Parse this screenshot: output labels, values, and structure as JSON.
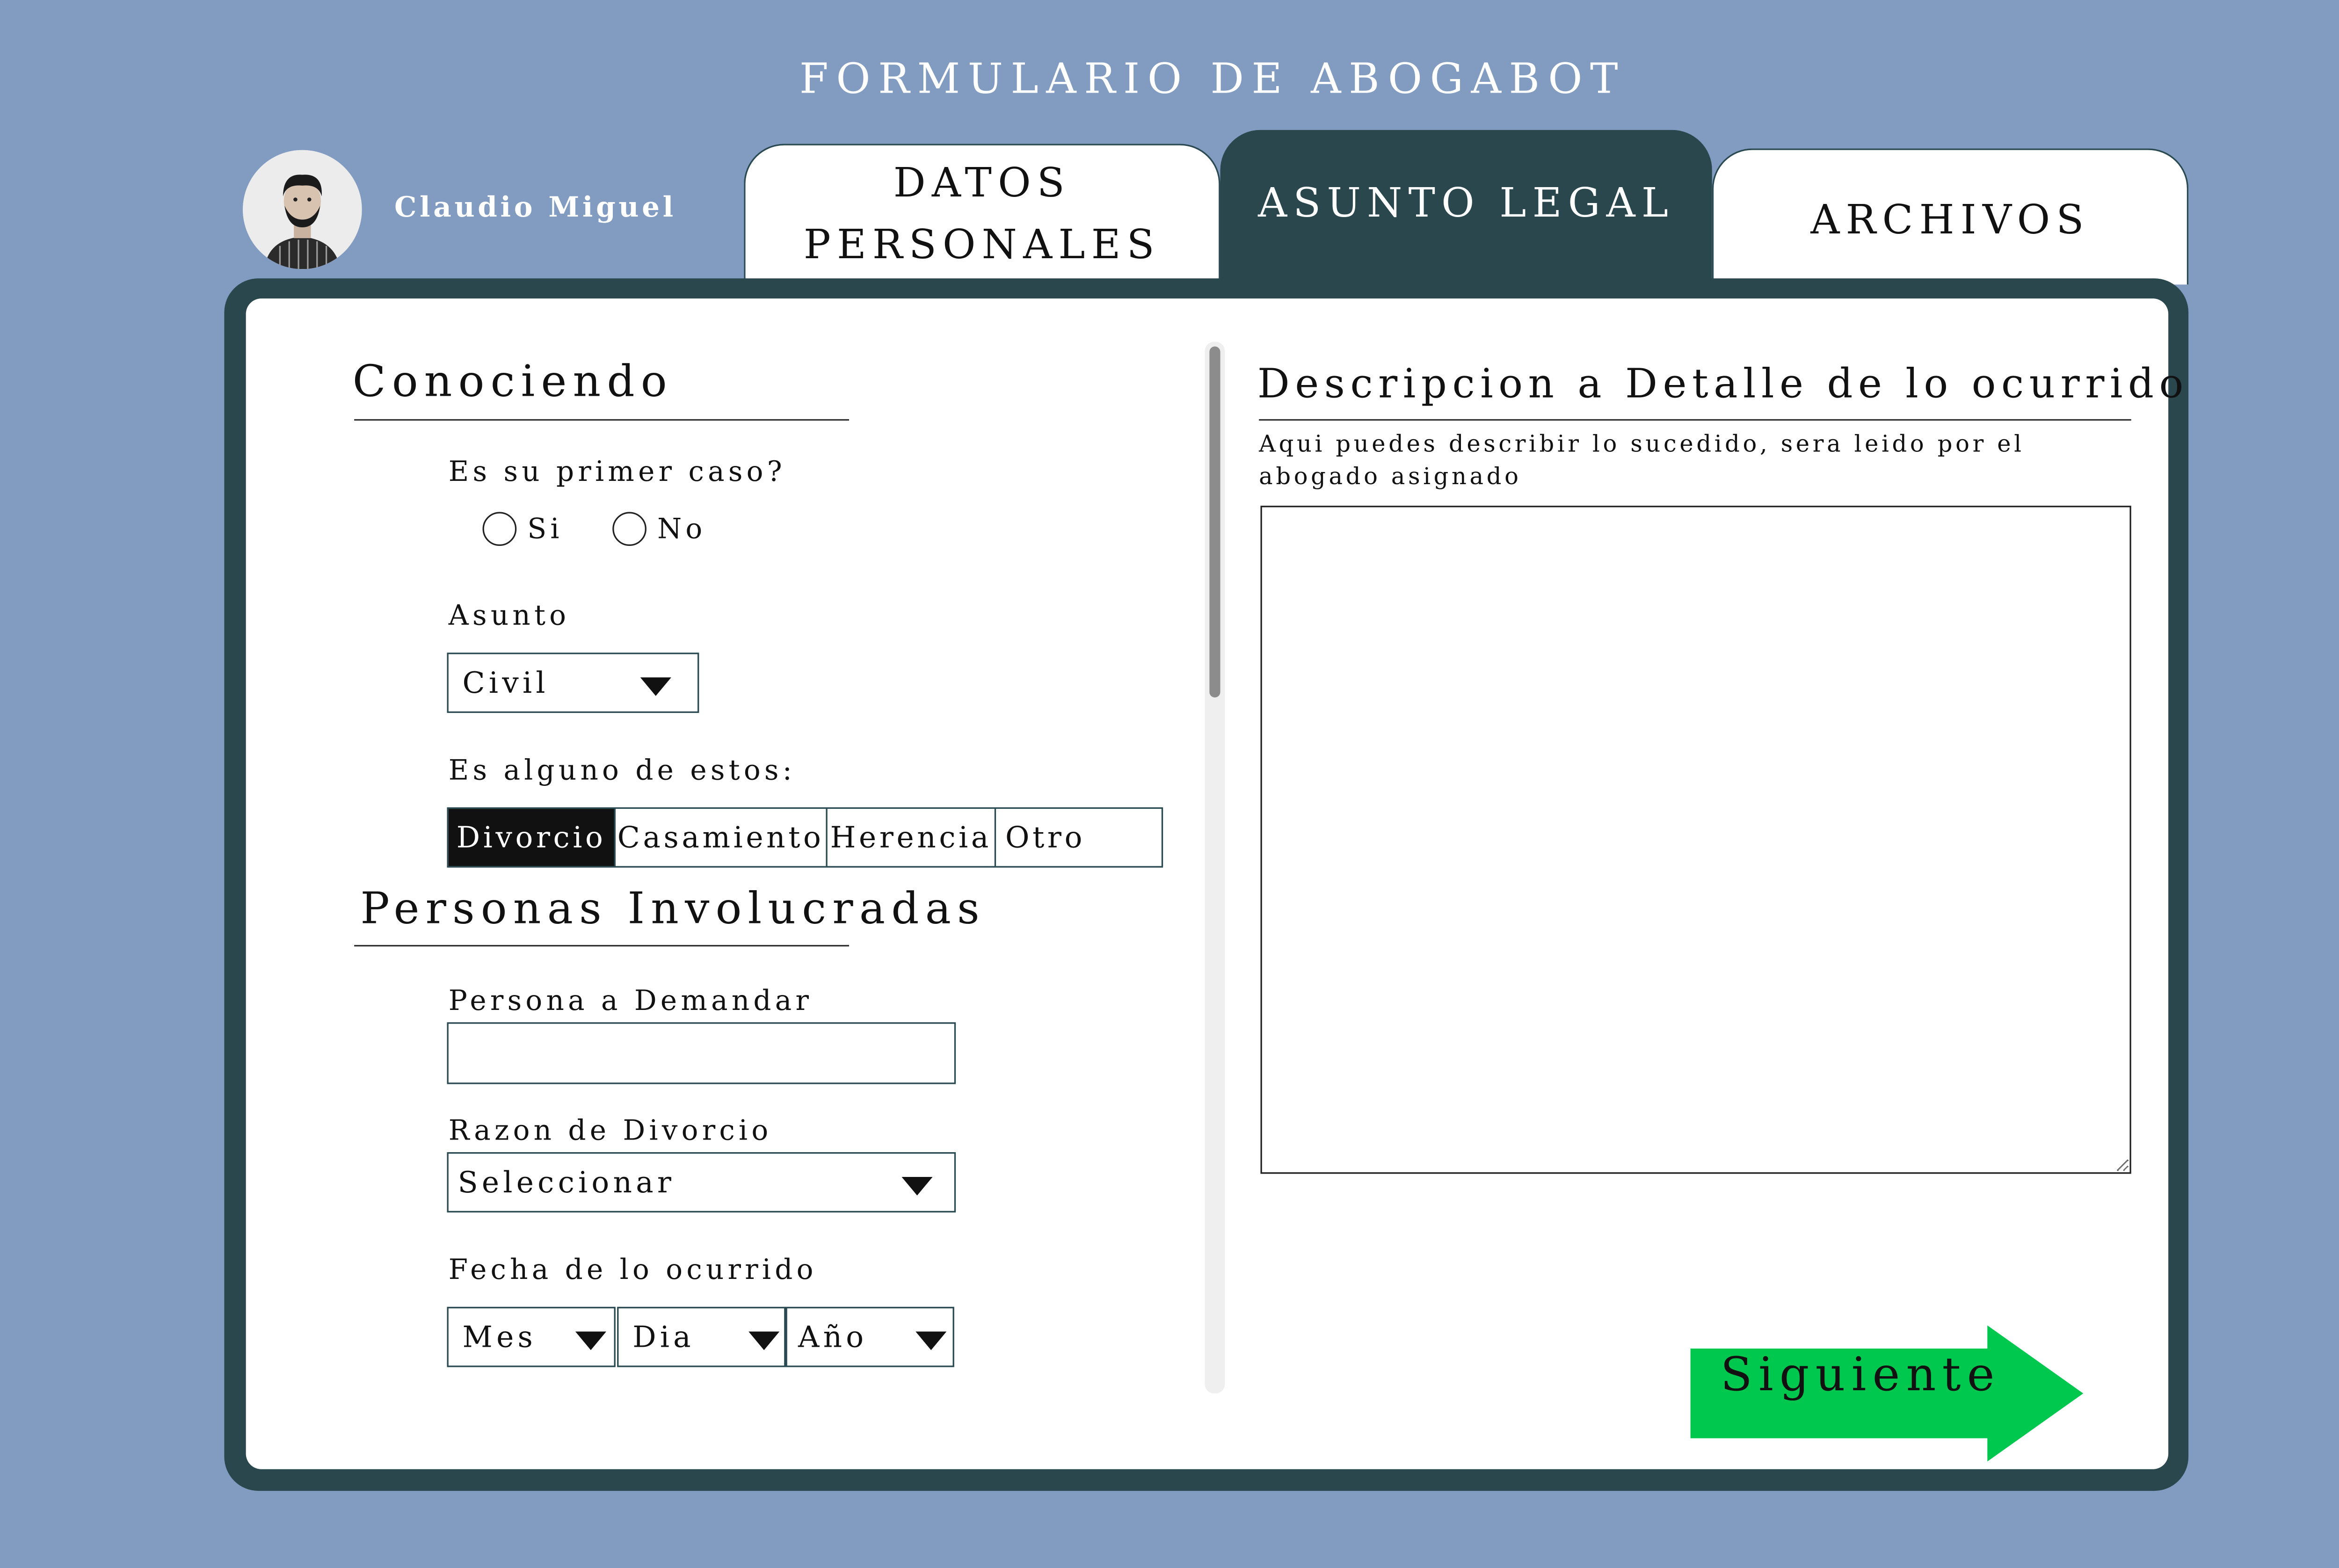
{
  "page": {
    "title": "FORMULARIO DE ABOGABOT"
  },
  "user": {
    "name": "Claudio Miguel"
  },
  "tabs": {
    "datos_line1": "DATOS",
    "datos_line2": "PERSONALES",
    "asunto": "ASUNTO LEGAL",
    "archivos": "ARCHIVOS",
    "active": "ASUNTO LEGAL"
  },
  "conociendo": {
    "title": "Conociendo",
    "primer_caso_label": "Es su primer caso?",
    "radio_si": "Si",
    "radio_no": "No",
    "asunto_label": "Asunto",
    "asunto_value": "Civil",
    "tipo_label": "Es alguno de estos:",
    "tipos": [
      "Divorcio",
      "Casamiento",
      "Herencia",
      "Otro"
    ],
    "tipo_selected": "Divorcio"
  },
  "personas": {
    "title": "Personas Involucradas",
    "demandar_label": "Persona a Demandar",
    "demandar_value": "",
    "razon_label": "Razon de Divorcio",
    "razon_value": "Seleccionar",
    "fecha_label": "Fecha de lo ocurrido",
    "mes": "Mes",
    "dia": "Dia",
    "anio": "Año"
  },
  "descripcion": {
    "title": "Descripcion a Detalle de lo ocurrido",
    "hint_line1": "Aqui puedes describir lo sucedido, sera leido por el",
    "hint_line2": "abogado asignado",
    "value": ""
  },
  "actions": {
    "next_label": "Siguiente"
  },
  "colors": {
    "background": "#829bc0",
    "frame": "#29474d",
    "next_button": "#00c84f",
    "selected_segment": "#111111"
  }
}
